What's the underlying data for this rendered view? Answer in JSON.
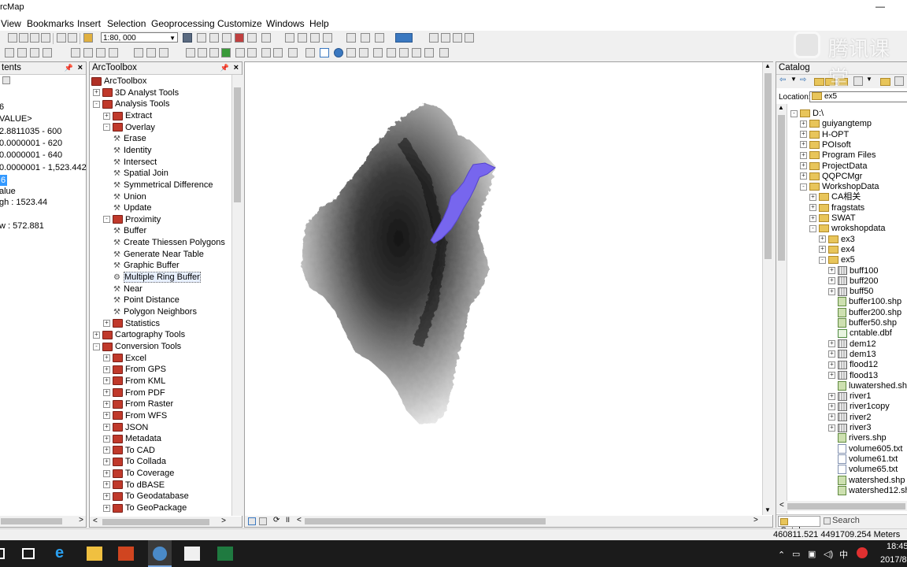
{
  "window": {
    "title": "rcMap"
  },
  "menu": {
    "items": [
      "View",
      "Bookmarks",
      "Insert",
      "Selection",
      "Geoprocessing",
      "Customize",
      "Windows",
      "Help"
    ]
  },
  "toolbar": {
    "scale": "1:80, 000"
  },
  "toc": {
    "title": "tents",
    "lines": [
      "6",
      "VALUE>",
      "2.8811035 - 600",
      "0.0000001 - 620",
      "0.0000001 - 640",
      "0.0000001 - 1,523.442",
      "6",
      "alue",
      "gh : 1523.44",
      "w : 572.881"
    ]
  },
  "arctoolbox": {
    "title": "ArcToolbox",
    "items": [
      {
        "label": "ArcToolbox",
        "indent": 0,
        "type": "root"
      },
      {
        "label": "3D Analyst Tools",
        "indent": 1,
        "type": "box",
        "exp": "+"
      },
      {
        "label": "Analysis Tools",
        "indent": 1,
        "type": "box",
        "exp": "-"
      },
      {
        "label": "Extract",
        "indent": 2,
        "type": "box",
        "exp": "+"
      },
      {
        "label": "Overlay",
        "indent": 2,
        "type": "box",
        "exp": "-"
      },
      {
        "label": "Erase",
        "indent": 3,
        "type": "tool"
      },
      {
        "label": "Identity",
        "indent": 3,
        "type": "tool"
      },
      {
        "label": "Intersect",
        "indent": 3,
        "type": "tool"
      },
      {
        "label": "Spatial Join",
        "indent": 3,
        "type": "tool"
      },
      {
        "label": "Symmetrical Difference",
        "indent": 3,
        "type": "tool"
      },
      {
        "label": "Union",
        "indent": 3,
        "type": "tool"
      },
      {
        "label": "Update",
        "indent": 3,
        "type": "tool"
      },
      {
        "label": "Proximity",
        "indent": 2,
        "type": "box",
        "exp": "-"
      },
      {
        "label": "Buffer",
        "indent": 3,
        "type": "tool"
      },
      {
        "label": "Create Thiessen Polygons",
        "indent": 3,
        "type": "tool"
      },
      {
        "label": "Generate Near Table",
        "indent": 3,
        "type": "tool"
      },
      {
        "label": "Graphic Buffer",
        "indent": 3,
        "type": "tool"
      },
      {
        "label": "Multiple Ring Buffer",
        "indent": 3,
        "type": "tool",
        "sel": true
      },
      {
        "label": "Near",
        "indent": 3,
        "type": "tool"
      },
      {
        "label": "Point Distance",
        "indent": 3,
        "type": "tool"
      },
      {
        "label": "Polygon Neighbors",
        "indent": 3,
        "type": "tool"
      },
      {
        "label": "Statistics",
        "indent": 2,
        "type": "box",
        "exp": "+"
      },
      {
        "label": "Cartography Tools",
        "indent": 1,
        "type": "box",
        "exp": "+"
      },
      {
        "label": "Conversion Tools",
        "indent": 1,
        "type": "box",
        "exp": "-"
      },
      {
        "label": "Excel",
        "indent": 2,
        "type": "box",
        "exp": "+"
      },
      {
        "label": "From GPS",
        "indent": 2,
        "type": "box",
        "exp": "+"
      },
      {
        "label": "From KML",
        "indent": 2,
        "type": "box",
        "exp": "+"
      },
      {
        "label": "From PDF",
        "indent": 2,
        "type": "box",
        "exp": "+"
      },
      {
        "label": "From Raster",
        "indent": 2,
        "type": "box",
        "exp": "+"
      },
      {
        "label": "From WFS",
        "indent": 2,
        "type": "box",
        "exp": "+"
      },
      {
        "label": "JSON",
        "indent": 2,
        "type": "box",
        "exp": "+"
      },
      {
        "label": "Metadata",
        "indent": 2,
        "type": "box",
        "exp": "+"
      },
      {
        "label": "To CAD",
        "indent": 2,
        "type": "box",
        "exp": "+"
      },
      {
        "label": "To Collada",
        "indent": 2,
        "type": "box",
        "exp": "+"
      },
      {
        "label": "To Coverage",
        "indent": 2,
        "type": "box",
        "exp": "+"
      },
      {
        "label": "To dBASE",
        "indent": 2,
        "type": "box",
        "exp": "+"
      },
      {
        "label": "To Geodatabase",
        "indent": 2,
        "type": "box",
        "exp": "+"
      },
      {
        "label": "To GeoPackage",
        "indent": 2,
        "type": "box",
        "exp": "+"
      }
    ]
  },
  "catalog": {
    "title": "Catalog",
    "location_label": "Location:",
    "location_value": "ex5",
    "items": [
      {
        "label": "D:\\",
        "indent": 0,
        "type": "folder",
        "exp": "-"
      },
      {
        "label": "guiyangtemp",
        "indent": 1,
        "type": "folder",
        "exp": "+"
      },
      {
        "label": "H-OPT",
        "indent": 1,
        "type": "folder",
        "exp": "+"
      },
      {
        "label": "POIsoft",
        "indent": 1,
        "type": "folder",
        "exp": "+"
      },
      {
        "label": "Program Files",
        "indent": 1,
        "type": "folder",
        "exp": "+"
      },
      {
        "label": "ProjectData",
        "indent": 1,
        "type": "folder",
        "exp": "+"
      },
      {
        "label": "QQPCMgr",
        "indent": 1,
        "type": "folder",
        "exp": "+"
      },
      {
        "label": "WorkshopData",
        "indent": 1,
        "type": "folder",
        "exp": "-"
      },
      {
        "label": "CA相关",
        "indent": 2,
        "type": "folder",
        "exp": "+"
      },
      {
        "label": "fragstats",
        "indent": 2,
        "type": "folder",
        "exp": "+"
      },
      {
        "label": "SWAT",
        "indent": 2,
        "type": "folder",
        "exp": "+"
      },
      {
        "label": "wrokshopdata",
        "indent": 2,
        "type": "folder",
        "exp": "-"
      },
      {
        "label": "ex3",
        "indent": 3,
        "type": "folder",
        "exp": "+"
      },
      {
        "label": "ex4",
        "indent": 3,
        "type": "folder",
        "exp": "+"
      },
      {
        "label": "ex5",
        "indent": 3,
        "type": "folder",
        "exp": "-"
      },
      {
        "label": "buff100",
        "indent": 4,
        "type": "grid",
        "exp": "+"
      },
      {
        "label": "buff200",
        "indent": 4,
        "type": "grid",
        "exp": "+"
      },
      {
        "label": "buff50",
        "indent": 4,
        "type": "grid",
        "exp": "+"
      },
      {
        "label": "buffer100.shp",
        "indent": 4,
        "type": "shp"
      },
      {
        "label": "buffer200.shp",
        "indent": 4,
        "type": "shp"
      },
      {
        "label": "buffer50.shp",
        "indent": 4,
        "type": "shp"
      },
      {
        "label": "cntable.dbf",
        "indent": 4,
        "type": "table"
      },
      {
        "label": "dem12",
        "indent": 4,
        "type": "grid",
        "exp": "+"
      },
      {
        "label": "dem13",
        "indent": 4,
        "type": "grid",
        "exp": "+"
      },
      {
        "label": "flood12",
        "indent": 4,
        "type": "grid",
        "exp": "+"
      },
      {
        "label": "flood13",
        "indent": 4,
        "type": "grid",
        "exp": "+"
      },
      {
        "label": "luwatershed.shp",
        "indent": 4,
        "type": "shp"
      },
      {
        "label": "river1",
        "indent": 4,
        "type": "grid",
        "exp": "+"
      },
      {
        "label": "river1copy",
        "indent": 4,
        "type": "grid",
        "exp": "+"
      },
      {
        "label": "river2",
        "indent": 4,
        "type": "grid",
        "exp": "+"
      },
      {
        "label": "river3",
        "indent": 4,
        "type": "grid",
        "exp": "+"
      },
      {
        "label": "rivers.shp",
        "indent": 4,
        "type": "shp"
      },
      {
        "label": "volume605.txt",
        "indent": 4,
        "type": "txt"
      },
      {
        "label": "volume61.txt",
        "indent": 4,
        "type": "txt"
      },
      {
        "label": "volume65.txt",
        "indent": 4,
        "type": "txt"
      },
      {
        "label": "watershed.shp",
        "indent": 4,
        "type": "shp"
      },
      {
        "label": "watershed12.sh",
        "indent": 4,
        "type": "shp"
      }
    ],
    "tabs": [
      "Catalog",
      "Search"
    ]
  },
  "status": {
    "coords": "460811.521  4491709.254 Meters"
  },
  "watermark": "腾讯课堂",
  "clock": {
    "time": "18:45",
    "date": "2017/8"
  },
  "tray": {
    "ime": "中"
  }
}
